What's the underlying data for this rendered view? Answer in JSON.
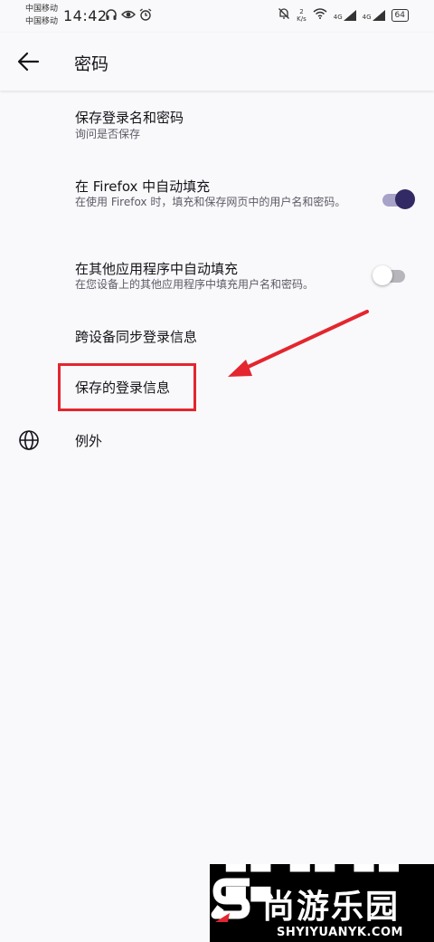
{
  "status_bar": {
    "carrier_1": "中国移动",
    "carrier_2": "中国移动",
    "time": "14:42",
    "net_speed_value": "2",
    "net_speed_unit": "K/s",
    "signal_1": "4G",
    "signal_2": "4G",
    "battery": "64"
  },
  "app_bar": {
    "title": "密码"
  },
  "settings": {
    "save_logins": {
      "title": "保存登录名和密码",
      "subtitle": "询问是否保存"
    },
    "autofill_firefox": {
      "title": "在 Firefox 中自动填充",
      "subtitle": "在使用 Firefox 时，填充和保存网页中的用户名和密码。",
      "enabled": true
    },
    "autofill_other_apps": {
      "title": "在其他应用程序中自动填充",
      "subtitle": "在您设备上的其他应用程序中填充用户名和密码。",
      "enabled": false
    },
    "sync_logins": {
      "title": "跨设备同步登录信息"
    },
    "saved_logins": {
      "title": "保存的登录信息"
    },
    "exceptions": {
      "title": "例外"
    }
  },
  "annotation": {
    "color": "#e3262f"
  },
  "theme": {
    "accent": "#312a64",
    "accent_track": "#a7a3c8"
  },
  "watermark": {
    "brand": "尚游乐园",
    "url": "SHYIYUANYK.COM"
  }
}
